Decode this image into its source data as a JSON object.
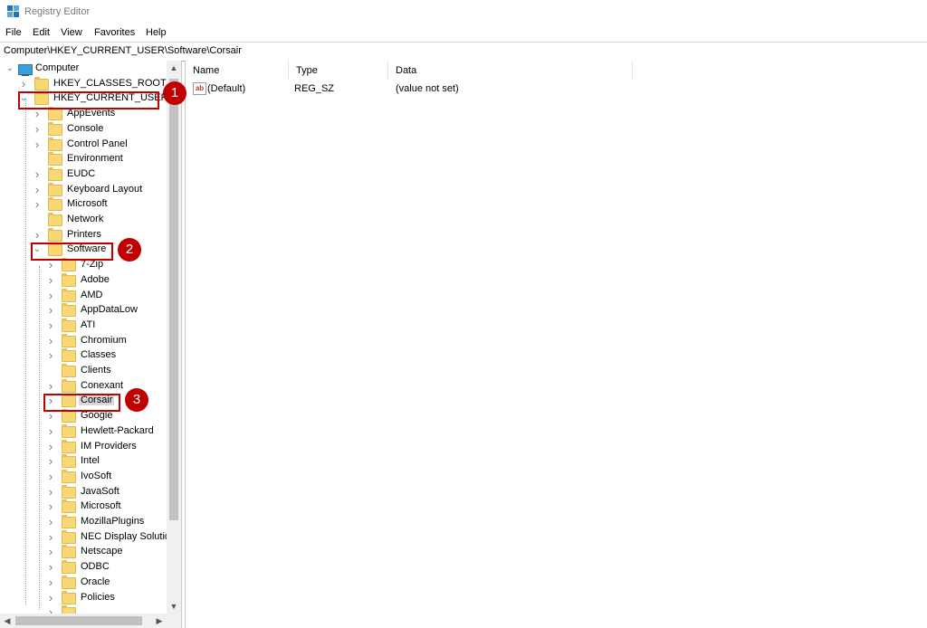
{
  "window": {
    "title": "Registry Editor",
    "app_icon": "registry-editor-icon"
  },
  "menu": [
    {
      "label": "File"
    },
    {
      "label": "Edit"
    },
    {
      "label": "View"
    },
    {
      "label": "Favorites"
    },
    {
      "label": "Help"
    }
  ],
  "address": {
    "path": "Computer\\HKEY_CURRENT_USER\\Software\\Corsair"
  },
  "tree": {
    "root_label": "Computer",
    "hives": [
      {
        "label": "HKEY_CLASSES_ROOT",
        "expanded": false
      },
      {
        "label": "HKEY_CURRENT_USER",
        "expanded": true
      }
    ],
    "hkcu_children": [
      {
        "label": "AppEvents",
        "has_children": true
      },
      {
        "label": "Console",
        "has_children": true
      },
      {
        "label": "Control Panel",
        "has_children": true
      },
      {
        "label": "Environment",
        "has_children": false
      },
      {
        "label": "EUDC",
        "has_children": true
      },
      {
        "label": "Keyboard Layout",
        "has_children": true
      },
      {
        "label": "Microsoft",
        "has_children": true
      },
      {
        "label": "Network",
        "has_children": false
      },
      {
        "label": "Printers",
        "has_children": true
      },
      {
        "label": "Software",
        "has_children": true,
        "expanded": true
      }
    ],
    "software_children": [
      {
        "label": "7-Zip",
        "has_children": true
      },
      {
        "label": "Adobe",
        "has_children": true
      },
      {
        "label": "AMD",
        "has_children": true
      },
      {
        "label": "AppDataLow",
        "has_children": true
      },
      {
        "label": "ATI",
        "has_children": true
      },
      {
        "label": "Chromium",
        "has_children": true
      },
      {
        "label": "Classes",
        "has_children": true
      },
      {
        "label": "Clients",
        "has_children": false
      },
      {
        "label": "Conexant",
        "has_children": true
      },
      {
        "label": "Corsair",
        "has_children": true,
        "selected": true
      },
      {
        "label": "Google",
        "has_children": true
      },
      {
        "label": "Hewlett-Packard",
        "has_children": true
      },
      {
        "label": "IM Providers",
        "has_children": true
      },
      {
        "label": "Intel",
        "has_children": true
      },
      {
        "label": "IvoSoft",
        "has_children": true
      },
      {
        "label": "JavaSoft",
        "has_children": true
      },
      {
        "label": "Microsoft",
        "has_children": true
      },
      {
        "label": "MozillaPlugins",
        "has_children": true
      },
      {
        "label": "NEC Display Solution",
        "has_children": true
      },
      {
        "label": "Netscape",
        "has_children": true
      },
      {
        "label": "ODBC",
        "has_children": true
      },
      {
        "label": "Oracle",
        "has_children": true
      },
      {
        "label": "Policies",
        "has_children": true
      },
      {
        "label": "",
        "has_children": true
      }
    ]
  },
  "values": {
    "columns": [
      {
        "label": "Name"
      },
      {
        "label": "Type"
      },
      {
        "label": "Data"
      }
    ],
    "rows": [
      {
        "name": "(Default)",
        "type": "REG_SZ",
        "data": "(value not set)",
        "icon": "string-value-icon"
      }
    ]
  },
  "callouts": [
    {
      "number": "1",
      "target": "HKEY_CURRENT_USER"
    },
    {
      "number": "2",
      "target": "Software"
    },
    {
      "number": "3",
      "target": "Corsair"
    }
  ],
  "colors": {
    "callout_red": "#c00000",
    "folder_yellow": "#f8d775",
    "computer_blue": "#39a0e0"
  }
}
